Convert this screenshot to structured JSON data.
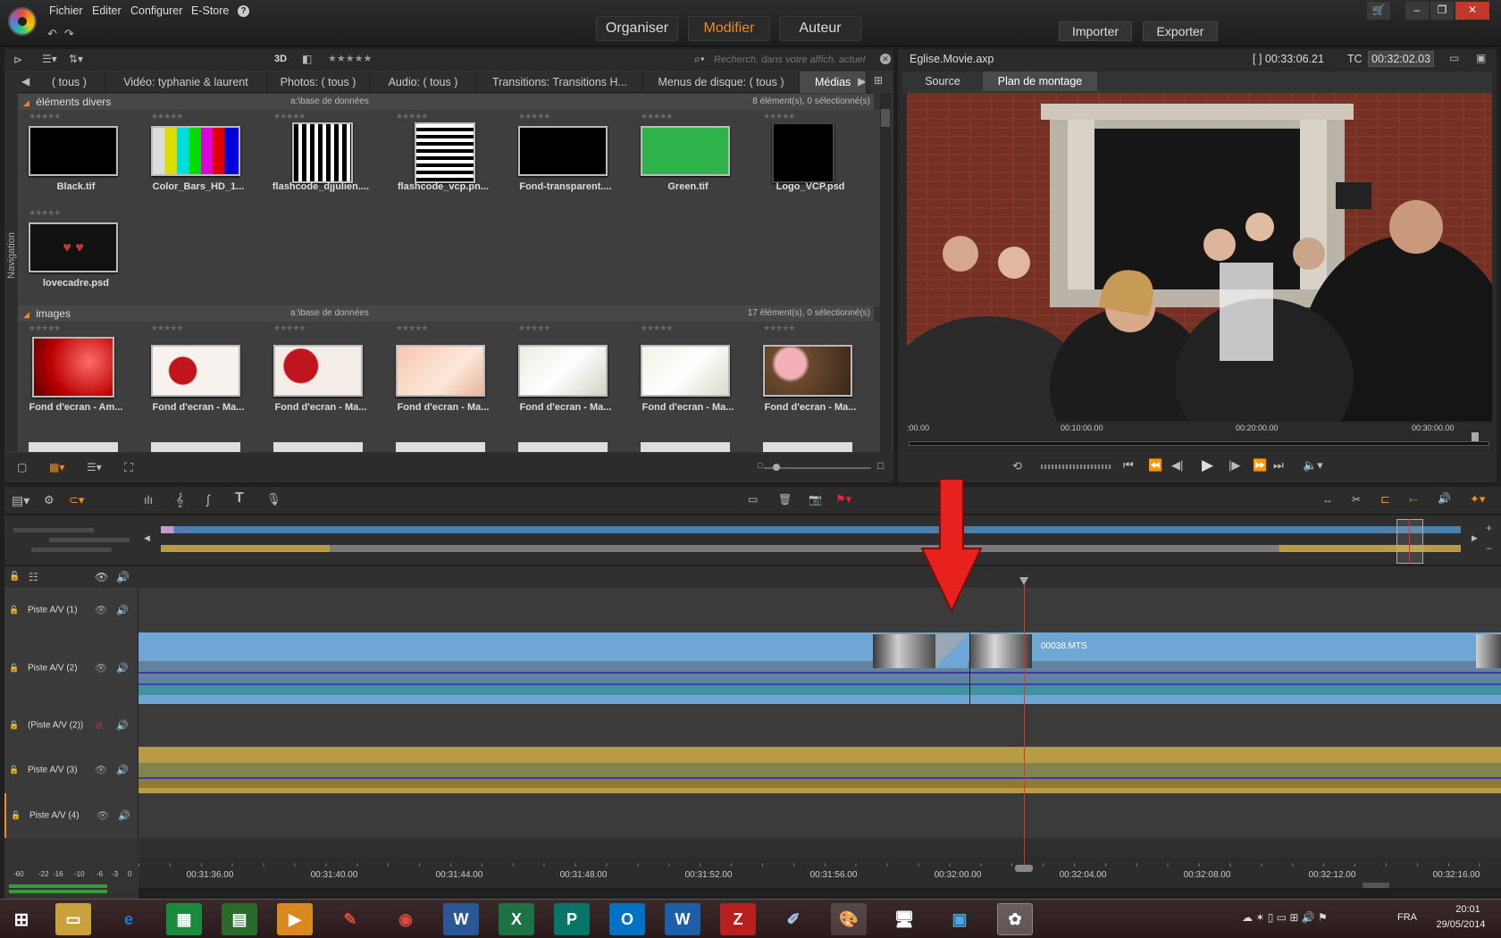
{
  "menu": [
    "Fichier",
    "Editer",
    "Configurer",
    "E-Store",
    "?"
  ],
  "nav": {
    "organiser": "Organiser",
    "modifier": "Modifier",
    "auteur": "Auteur"
  },
  "top_actions": {
    "importer": "Importer",
    "exporter": "Exporter"
  },
  "library": {
    "toolbar": {
      "mode3d": "3D",
      "stars": "★★★★★",
      "search_placeholder": "Recherch. dans votre affich. actuel"
    },
    "side_label": "Navigation",
    "tabs": [
      "( tous )",
      "Vidéo: typhanie & laurent",
      "Photos: ( tous )",
      "Audio: ( tous )",
      "Transitions: Transitions H...",
      "Menus de disque: ( tous )",
      "Médias"
    ],
    "sections": [
      {
        "title": "éléments divers",
        "source": "a:\\base de données",
        "count": "8 élément(s), 0 sélectionné(s)",
        "items": [
          "Black.tif",
          "Color_Bars_HD_1...",
          "flashcode_djjulien....",
          "flashcode_vcp.pn...",
          "Fond-transparent....",
          "Green.tif",
          "Logo_VCP.psd",
          "lovecadre.psd"
        ]
      },
      {
        "title": "images",
        "source": "a:\\base de données",
        "count": "17 élément(s), 0 sélectionné(s)",
        "items": [
          "Fond d'ecran - Am...",
          "Fond d'ecran - Ma...",
          "Fond d'ecran - Ma...",
          "Fond d'ecran - Ma...",
          "Fond d'ecran - Ma...",
          "Fond d'ecran - Ma...",
          "Fond d'ecran - Ma..."
        ]
      }
    ]
  },
  "preview": {
    "filename": "Eglise.Movie.axp",
    "duration": "[ ] 00:33:06.21",
    "tc_label": "TC",
    "tc_value": "00:32:02.03",
    "tabs": {
      "source": "Source",
      "plan": "Plan de montage"
    },
    "scrub_labels": [
      ":00.00",
      "00:10:00.00",
      "00:20:00.00",
      "00:30:00.00"
    ]
  },
  "timeline": {
    "tracks": [
      {
        "label": "Piste A/V (1)"
      },
      {
        "label": "Piste A/V (2)",
        "clip": "00038.MTS"
      },
      {
        "label": "(Piste A/V (2))"
      },
      {
        "label": "Piste A/V (3)"
      },
      {
        "label": "Piste A/V (4)"
      }
    ],
    "ruler": [
      "00:31:36.00",
      "00:31:40.00",
      "00:31:44.00",
      "00:31:48.00",
      "00:31:52.00",
      "00:31:56.00",
      "00:32:00.00",
      "00:32:04.00",
      "00:32:08.00",
      "00:32:12.00",
      "00:32:16.00"
    ],
    "meter_labels": [
      "-60",
      "-22",
      "-16",
      "-10",
      "-6",
      "-3",
      "0"
    ]
  },
  "taskbar": {
    "lang": "FRA",
    "time": "20:01",
    "date": "29/05/2014"
  },
  "colors": {
    "accent": "#f08a24",
    "video_clip": "#6ea6d6",
    "audio_clip": "#b89c45",
    "playhead": "#e23030",
    "arrow": "#e8201e"
  }
}
